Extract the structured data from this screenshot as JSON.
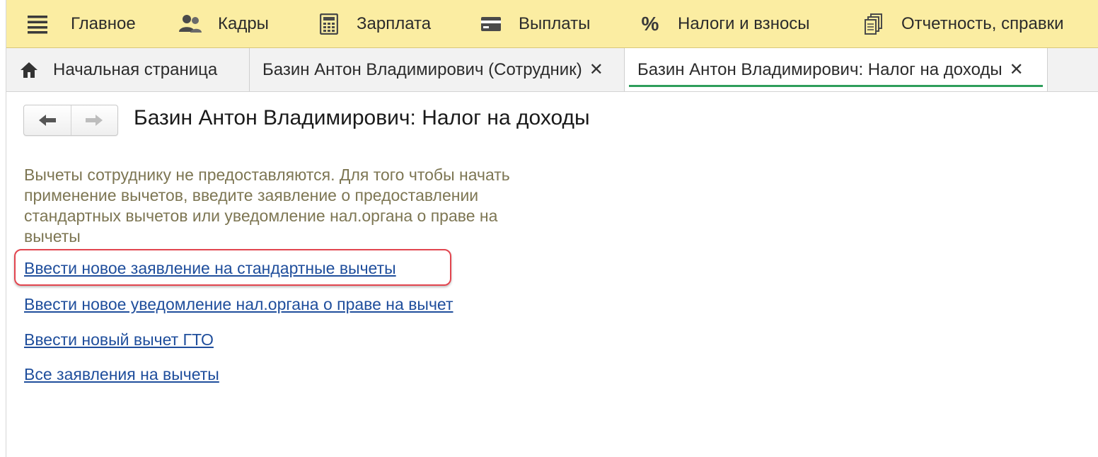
{
  "topbar": {
    "items": [
      {
        "label": "Главное",
        "icon": "home-lines-icon"
      },
      {
        "label": "Кадры",
        "icon": "people-icon"
      },
      {
        "label": "Зарплата",
        "icon": "calculator-icon"
      },
      {
        "label": "Выплаты",
        "icon": "card-icon"
      },
      {
        "label": "Налоги и взносы",
        "icon": "percent-icon"
      },
      {
        "label": "Отчетность, справки",
        "icon": "documents-icon"
      }
    ]
  },
  "tabs": [
    {
      "label": "Начальная страница",
      "icon": "home-icon"
    },
    {
      "label": "Базин Антон Владимирович (Сотрудник)",
      "close": "✕"
    },
    {
      "label": "Базин Антон Владимирович: Налог на доходы",
      "close": "✕"
    }
  ],
  "page": {
    "title": "Базин Антон Владимирович: Налог на доходы",
    "info_text": "Вычеты сотруднику не предоставляются. Для того чтобы начать применение вычетов, введите заявление о предоставлении стандартных вычетов или уведомление нал.органа о праве на вычеты",
    "links": [
      "Ввести новое заявление на стандартные вычеты",
      "Ввести новое уведомление нал.органа о праве на вычет",
      "Ввести новый вычет ГТО",
      "Все заявления на вычеты"
    ]
  },
  "colors": {
    "topbar_bg": "#fbeda2",
    "link": "#1f4e9c",
    "info_text": "#7d7653",
    "active_tab_underline": "#2e9e5b",
    "highlight_border": "#e2454f"
  }
}
